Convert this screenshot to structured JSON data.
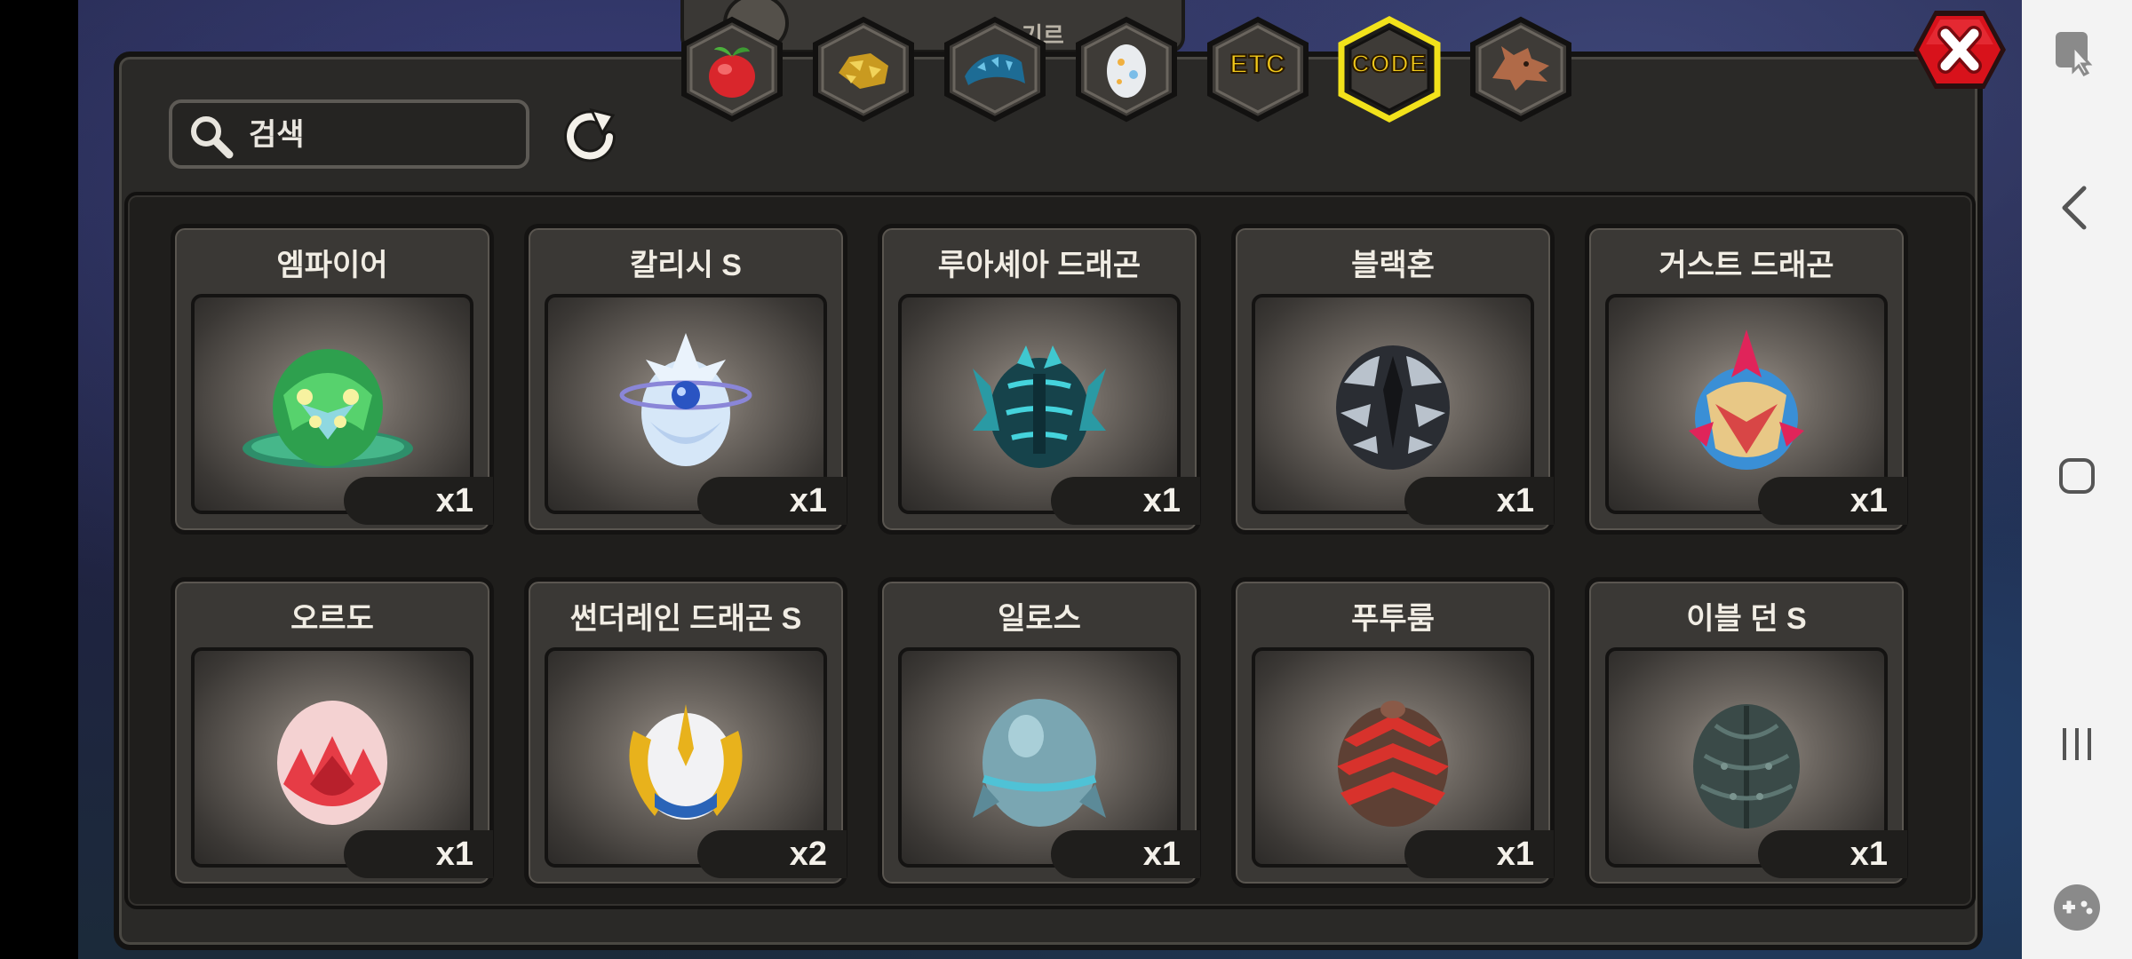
{
  "search": {
    "placeholder": "검색",
    "value": ""
  },
  "tabs": [
    {
      "id": "fruit",
      "icon": "fruit-icon",
      "label": "",
      "selected": false
    },
    {
      "id": "gold",
      "icon": "gold-nugget-icon",
      "label": "",
      "selected": false
    },
    {
      "id": "scale",
      "icon": "dragon-scale-icon",
      "label": "",
      "selected": false
    },
    {
      "id": "egg",
      "icon": "egg-icon",
      "label": "",
      "selected": false
    },
    {
      "id": "etc",
      "icon": "",
      "label": "ETC",
      "selected": false
    },
    {
      "id": "code",
      "icon": "",
      "label": "CODE",
      "selected": true
    },
    {
      "id": "dragon",
      "icon": "dragon-head-icon",
      "label": "",
      "selected": false
    }
  ],
  "top_tab_stub": {
    "label": "기르"
  },
  "items": [
    {
      "name": "엠파이어",
      "qty": "x1",
      "egg": "green-egg"
    },
    {
      "name": "칼리시 S",
      "qty": "x1",
      "egg": "crystal-egg"
    },
    {
      "name": "루아셰아 드래곤",
      "qty": "x1",
      "egg": "teal-spiked-egg"
    },
    {
      "name": "블랙혼",
      "qty": "x1",
      "egg": "black-horned-egg"
    },
    {
      "name": "거스트 드래곤",
      "qty": "x1",
      "egg": "crested-egg"
    },
    {
      "name": "오르도",
      "qty": "x1",
      "egg": "red-crystal-egg"
    },
    {
      "name": "썬더레인 드래곤 S",
      "qty": "x2",
      "egg": "gold-winged-egg"
    },
    {
      "name": "일로스",
      "qty": "x1",
      "egg": "blue-finned-egg"
    },
    {
      "name": "푸투룸",
      "qty": "x1",
      "egg": "red-pagoda-egg"
    },
    {
      "name": "이블 던 S",
      "qty": "x1",
      "egg": "dark-scaled-egg"
    }
  ],
  "colors": {
    "selected_tab_border": "#f2e21b",
    "close_button": "#d8121b",
    "panel": "#2a2927"
  }
}
